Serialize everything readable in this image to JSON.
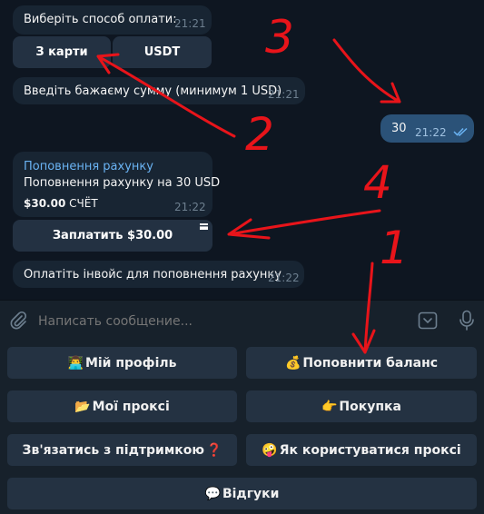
{
  "messages": {
    "payment_prompt": {
      "text": "Виберіть способ оплати:",
      "time": "21:21"
    },
    "payment_buttons": {
      "card": "З карти",
      "usdt": "USDT"
    },
    "amount_prompt": {
      "text": "Введіть бажаєму сумму (минимум 1 USD)",
      "time": "21:21"
    },
    "outgoing": {
      "text": "30",
      "time": "21:22"
    },
    "invoice": {
      "title": "Поповнення рахунку",
      "description": "Поповнення рахунку на 30 USD",
      "amount": "$30.00",
      "amount_suffix": "СЧЁТ",
      "time": "21:22",
      "pay_button": "Заплатить $30.00"
    },
    "pay_notice": {
      "text": "Оплатіть інвойс для поповнення рахунку",
      "time": "21:22"
    }
  },
  "composer": {
    "placeholder": "Написать сообщение..."
  },
  "keyboard": {
    "profile": {
      "emoji": "👨‍💻",
      "label": "Мій профіль"
    },
    "topup": {
      "emoji": "💰",
      "label": "Поповнити баланс"
    },
    "proxies": {
      "emoji": "📂",
      "label": "Мої проксі"
    },
    "purchase": {
      "emoji": "👉",
      "label": "Покупка"
    },
    "support": {
      "label": "Зв'язатись з підтримкою",
      "emoji": "❓"
    },
    "howto": {
      "emoji": "🤪",
      "label": "Як користуватися проксі"
    },
    "reviews": {
      "emoji": "💬",
      "label": "Відгуки"
    }
  },
  "annotations": {
    "n1": "1",
    "n2": "2",
    "n3": "3",
    "n4": "4"
  },
  "colors": {
    "chat_bg": "#0e1621",
    "bubble_in": "#182533",
    "bubble_out": "#2b5278",
    "accent_link": "#6ab3f3",
    "annotation_red": "#e8141a"
  }
}
